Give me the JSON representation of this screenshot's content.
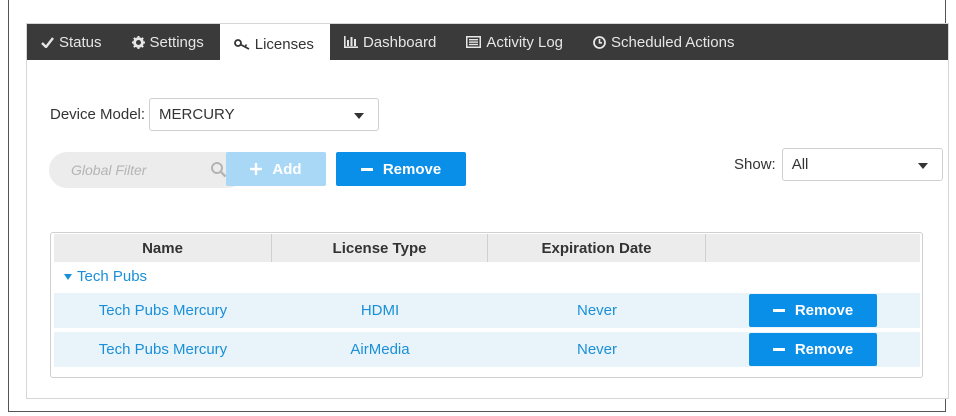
{
  "tabs": [
    {
      "label": "Status",
      "icon": "check-icon"
    },
    {
      "label": "Settings",
      "icon": "gear-icon"
    },
    {
      "label": "Licenses",
      "icon": "key-icon"
    },
    {
      "label": "Dashboard",
      "icon": "bar-chart-icon"
    },
    {
      "label": "Activity Log",
      "icon": "list-icon"
    },
    {
      "label": "Scheduled Actions",
      "icon": "clock-icon"
    }
  ],
  "active_tab": "Licenses",
  "device_model": {
    "label": "Device Model:",
    "value": "MERCURY"
  },
  "filter": {
    "placeholder": "Global Filter"
  },
  "toolbar": {
    "add_label": "Add",
    "remove_label": "Remove"
  },
  "show": {
    "label": "Show:",
    "value": "All"
  },
  "table": {
    "columns": [
      "Name",
      "License Type",
      "Expiration Date",
      ""
    ],
    "group": "Tech Pubs",
    "rows": [
      {
        "name": "Tech Pubs Mercury",
        "type": "HDMI",
        "expiration": "Never",
        "action": "Remove"
      },
      {
        "name": "Tech Pubs Mercury",
        "type": "AirMedia",
        "expiration": "Never",
        "action": "Remove"
      }
    ]
  },
  "colors": {
    "accent": "#0a8fe8",
    "accent_disabled": "#a9d8f7",
    "link": "#1a8fd8",
    "tabbar": "#3a3a3a",
    "row_bg": "#e9f4fa"
  }
}
